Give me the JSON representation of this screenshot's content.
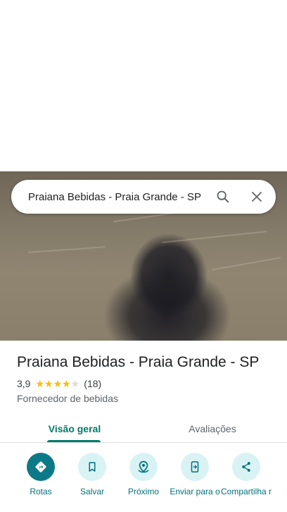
{
  "search": {
    "query": "Praiana Bebidas - Praia Grande - SP",
    "search_icon": "search-icon",
    "close_icon": "close-icon"
  },
  "place": {
    "name": "Praiana Bebidas - Praia Grande - SP",
    "rating": "3,9",
    "rating_value": 3.9,
    "reviews_count": "(18)",
    "category": "Fornecedor de bebidas"
  },
  "tabs": [
    {
      "label": "Visão geral",
      "selected": true
    },
    {
      "label": "Avaliações",
      "selected": false
    }
  ],
  "actions": [
    {
      "label": "Rotas",
      "icon": "directions-icon"
    },
    {
      "label": "Salvar",
      "icon": "bookmark-icon"
    },
    {
      "label": "Próximo",
      "icon": "nearby-icon"
    },
    {
      "label": "Enviar para o",
      "icon": "send-to-phone-icon"
    },
    {
      "label": "Compartilha r",
      "icon": "share-icon"
    }
  ],
  "colors": {
    "accent": "#00796b",
    "star": "#fbbc04",
    "action_bg": "#d9f3f5",
    "primary_action": "#0b7a86"
  }
}
